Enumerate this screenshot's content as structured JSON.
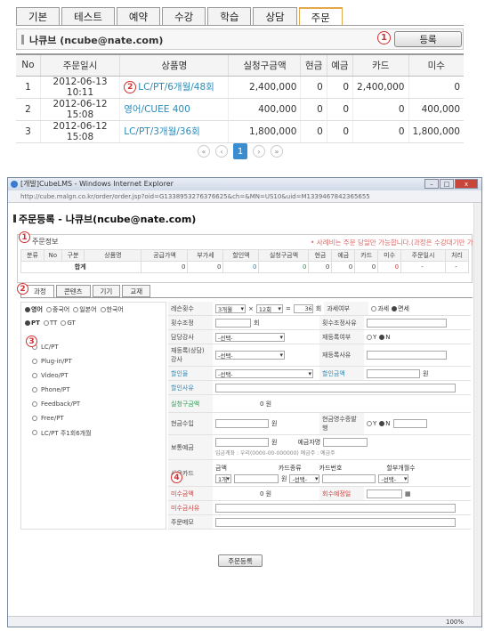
{
  "tabs": [
    "기본",
    "테스트",
    "예약",
    "수강",
    "학습",
    "상담",
    "주문"
  ],
  "active_tab": "주문",
  "customer": {
    "title": "나큐브 (ncube@nate.com)"
  },
  "markers": {
    "m1": "1",
    "m2": "2",
    "m3": "3",
    "m4": "4"
  },
  "register_button": "등록",
  "orders_table": {
    "headers": [
      "No",
      "주문일시",
      "상품명",
      "실청구금액",
      "현금",
      "예금",
      "카드",
      "미수"
    ],
    "rows": [
      {
        "no": "1",
        "date": "2012-06-13 10:11",
        "product": "LC/PT/6개월/48회",
        "amount": "2,400,000",
        "cash": "0",
        "deposit": "0",
        "card": "2,400,000",
        "unpaid": "0"
      },
      {
        "no": "2",
        "date": "2012-06-12 15:08",
        "product": "영어/CUEE 400",
        "amount": "400,000",
        "cash": "0",
        "deposit": "0",
        "card": "0",
        "unpaid": "400,000"
      },
      {
        "no": "3",
        "date": "2012-06-12 15:08",
        "product": "LC/PT/3개월/36회",
        "amount": "1,800,000",
        "cash": "0",
        "deposit": "0",
        "card": "0",
        "unpaid": "1,800,000"
      }
    ]
  },
  "pager": {
    "first": "«",
    "prev": "‹",
    "current": "1",
    "next": "›",
    "last": "»"
  },
  "browser": {
    "title": "[개발]CubeLMS - Windows Internet Explorer",
    "address": "http://cube.malgn.co.kr/order/order.jsp?oid=G1338953276376625&ch=&MN=US10&uid=M1339467842365655",
    "zoom": "100%",
    "min": "–",
    "max": "□",
    "close": "x"
  },
  "order_form": {
    "title": "주문등록 - 나큐브(ncube@nate.com)",
    "section1_label": "주문정보",
    "section1_note": "• 사례비는 주문 당일만 가능합니다.(과정은 수강대기만 가능)",
    "summary_headers": [
      "분류",
      "No",
      "구분",
      "상품명",
      "공급가액",
      "부가세",
      "할인액",
      "실청구금액",
      "현금",
      "예금",
      "카드",
      "미수",
      "주문일시",
      "처리"
    ],
    "summary_total": {
      "label": "합계",
      "supply": "0",
      "tax": "0",
      "discount": "0",
      "billed": "0",
      "cash": "0",
      "deposit": "0",
      "card": "0",
      "unpaid": "0",
      "date": "-",
      "proc": "-"
    },
    "sub_tabs": [
      "과정",
      "콘텐츠",
      "기기",
      "교재"
    ],
    "languages": [
      "영어",
      "중국어",
      "일본어",
      "한국어"
    ],
    "lesson_types": [
      "PT",
      "TT",
      "GT"
    ],
    "products": [
      "LC/PT",
      "Plug-in/PT",
      "Video/PT",
      "Phone/PT",
      "Feedback/PT",
      "Free/PT",
      "LC/PT 주1회6개월"
    ],
    "fields": {
      "lesson_count": "레슨횟수",
      "months": "3개월",
      "times": "12회",
      "total_times": "36",
      "unit_times": "회",
      "tax_type": "과세여부",
      "tax": "과세",
      "tax_free": "면세",
      "count_adjust": "횟수조정",
      "count_unit": "회",
      "count_reason": "횟수조정사유",
      "teacher": "담당강사",
      "select": "-선택-",
      "re_register": "재등록여부",
      "yes": "Y",
      "no": "N",
      "re_teacher": "재등록(상담)강사",
      "re_reason": "재등록사유",
      "discount_rate": "할인율",
      "discount_amount": "할인금액",
      "won": "원",
      "discount_reason": "할인사유",
      "billed": "실청구금액",
      "billed_value": "0 원",
      "cash_receipt": "현금수입",
      "cash_receipt_issue": "현금영수증발행",
      "deposit_receipt": "보통예금",
      "depositor": "예금자명",
      "account_info": "입금계좌 : 우리(0000-00-000000) 예금주 : 예금주",
      "card_use": "사용카드",
      "card_amount": "금액",
      "card_type": "카드종류",
      "card_number": "카드번호",
      "installment": "할부개월수",
      "card_count": "1개",
      "unpaid": "미수금액",
      "unpaid_value": "0 원",
      "unpaid_due": "회수예정일",
      "unpaid_reason": "미수금사유",
      "memo": "주문메모"
    },
    "submit": "주문등록"
  }
}
